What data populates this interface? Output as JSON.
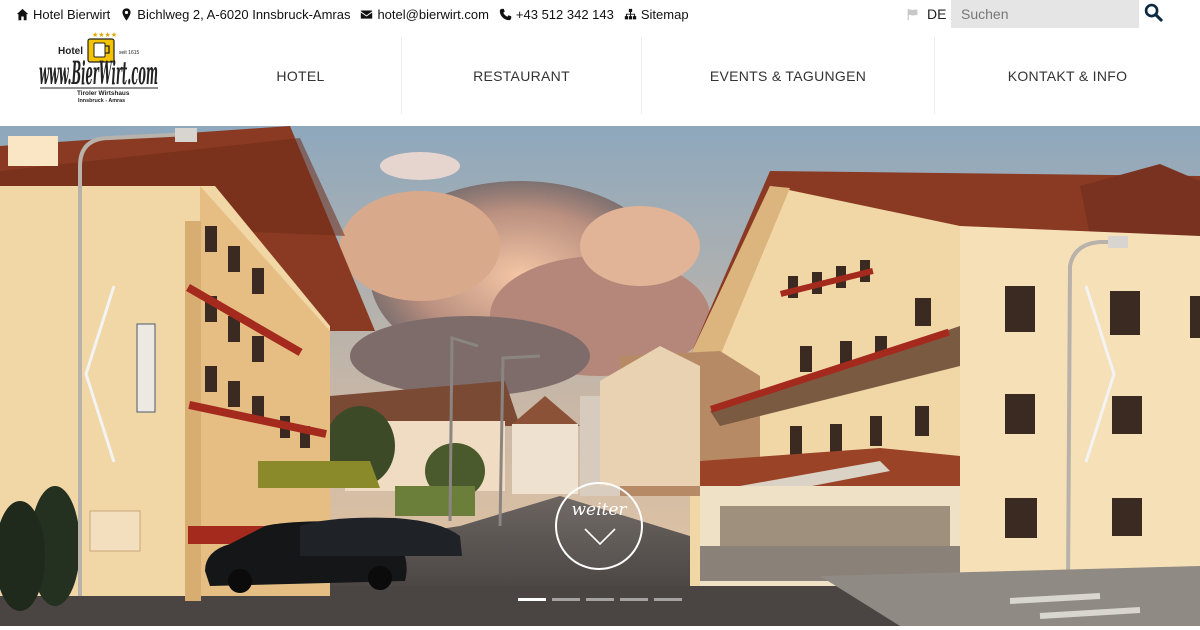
{
  "topbar": {
    "hotel_name": "Hotel Bierwirt",
    "address": "Bichlweg 2, A-6020 Innsbruck-Amras",
    "email": "hotel@bierwirt.com",
    "phone": "+43 512 342 143",
    "sitemap": "Sitemap",
    "language": "DE",
    "search_placeholder": "Suchen"
  },
  "logo": {
    "top_left": "Hotel",
    "top_right": "seit 1615",
    "main": "www.BierWirt.com",
    "line1": "Tiroler Wirtshaus",
    "line2": "Innsbruck - Amras"
  },
  "nav": {
    "items": [
      {
        "label": "HOTEL"
      },
      {
        "label": "RESTAURANT"
      },
      {
        "label": "EVENTS & TAGUNGEN"
      },
      {
        "label": "KONTAKT & INFO"
      }
    ]
  },
  "hero": {
    "next_label": "weiter",
    "slide_count": 5,
    "active_slide": 1
  },
  "colors": {
    "logo_yellow": "#f5c400",
    "roof": "#8a3a22",
    "facade": "#f1d6a6"
  }
}
